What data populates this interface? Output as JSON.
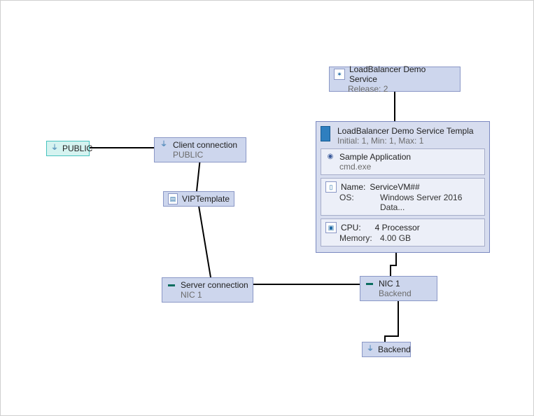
{
  "nodes": {
    "public": {
      "label": "PUBLIC"
    },
    "client_conn": {
      "title": "Client connection",
      "subtitle": "PUBLIC"
    },
    "vip": {
      "title": "VIPTemplate"
    },
    "server_conn": {
      "title": "Server connection",
      "subtitle": "NIC 1"
    },
    "nic1": {
      "title": "NIC 1",
      "subtitle": "Backend"
    },
    "backend": {
      "label": "Backend"
    },
    "service": {
      "title": "LoadBalancer Demo Service",
      "subtitle": "Release: 2"
    },
    "template": {
      "title": "LoadBalancer Demo Service Templa",
      "subtitle": "Initial: 1, Min: 1, Max: 1",
      "app": {
        "title": "Sample Application",
        "sub": "cmd.exe"
      },
      "os": {
        "name_label": "Name:",
        "name_value": "ServiceVM##",
        "os_label": "OS:",
        "os_value": "Windows Server 2016 Data..."
      },
      "hw": {
        "cpu_label": "CPU:",
        "cpu_value": "4 Processor",
        "mem_label": "Memory:",
        "mem_value": "4.00 GB"
      }
    }
  }
}
